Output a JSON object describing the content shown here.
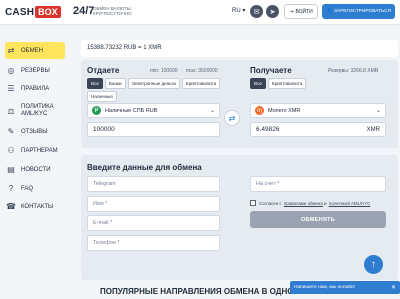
{
  "header": {
    "logo_cash": "CASH",
    "logo_box": "BOX",
    "hours": "24/7",
    "hours_sub": "ОБМЕН ВАЛЮТЫ, КРУГЛОСУТОЧНО",
    "language": "RU",
    "login_label": "ВОЙТИ",
    "register_label": "ЗАРЕГИСТРИРОВАТЬСЯ"
  },
  "sidebar": {
    "items": [
      {
        "label": "ОБМЕН",
        "icon": "exchange-icon"
      },
      {
        "label": "РЕЗЕРВЫ",
        "icon": "reserve-icon"
      },
      {
        "label": "ПРАВИЛА",
        "icon": "rules-icon"
      },
      {
        "label": "ПОЛИТИКА AML/KYC",
        "icon": "policy-icon"
      },
      {
        "label": "ОТЗЫВЫ",
        "icon": "reviews-icon"
      },
      {
        "label": "ПАРТНЕРАМ",
        "icon": "partners-icon"
      },
      {
        "label": "НОВОСТИ",
        "icon": "news-icon"
      },
      {
        "label": "FAQ",
        "icon": "faq-icon"
      },
      {
        "label": "КОНТАКТЫ",
        "icon": "contacts-icon"
      }
    ]
  },
  "rate": "15388.73232 RUB = 1 XMR",
  "give": {
    "title": "Отдаете",
    "min": "min: 100000",
    "max": "max: 3500000",
    "tabs": [
      "Все",
      "Банки",
      "Электронные деньги",
      "Криптовалюта",
      "Наличные"
    ],
    "currency": "Наличные СПБ RUB",
    "amount": "100000"
  },
  "get": {
    "title": "Получаете",
    "reserve": "Резервы: 3266.8 XMR",
    "tabs": [
      "Все",
      "Криптовалюта"
    ],
    "currency": "Monero XMR",
    "amount": "6.49826",
    "amount_unit": "XMR"
  },
  "form": {
    "title": "Введите данные для обмена",
    "telegram": "Telegram",
    "name": "Имя *",
    "email": "E-mail *",
    "phone": "Телефон *",
    "account": "На счет *",
    "agree_text": "Согласен с",
    "agree_link": "правилами обмена",
    "agree_and": "и",
    "agree_link2": "политикой AML/KYC",
    "submit": "ОБМЕНЯТЬ"
  },
  "chat": "Напишите нам, мы онлайн!",
  "bottom_heading": "ПОПУЛЯРНЫЕ НАПРАВЛЕНИЯ ОБМЕНА В ОДНОМ МЕСТЕ",
  "colors": {
    "accent": "#2e7dd1",
    "active": "#ffe45c",
    "brand": "#d9342b"
  }
}
